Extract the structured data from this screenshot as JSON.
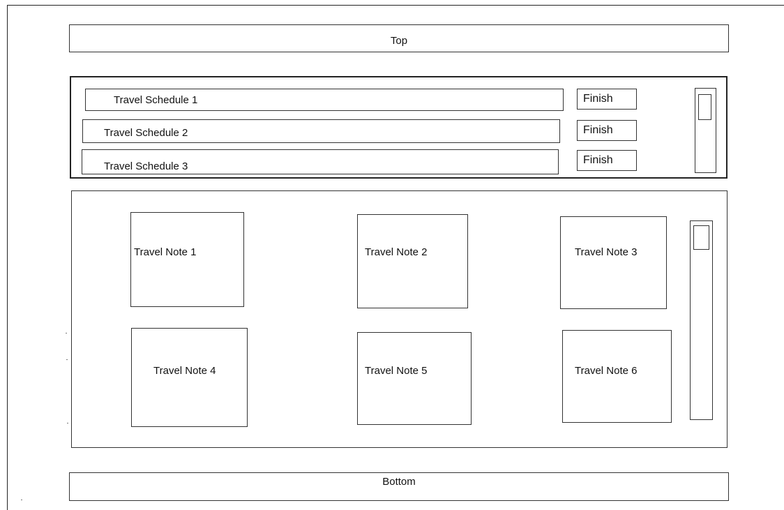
{
  "header": {
    "label": "Top"
  },
  "schedules": [
    {
      "label": "Travel Schedule 1",
      "action": "Finish"
    },
    {
      "label": "Travel Schedule 2",
      "action": "Finish"
    },
    {
      "label": "Travel Schedule 3",
      "action": "Finish"
    }
  ],
  "notes": [
    {
      "label": "Travel Note 1"
    },
    {
      "label": "Travel Note 2"
    },
    {
      "label": "Travel Note 3"
    },
    {
      "label": "Travel Note 4"
    },
    {
      "label": "Travel Note 5"
    },
    {
      "label": "Travel Note 6"
    }
  ],
  "footer": {
    "label": "Bottom"
  }
}
